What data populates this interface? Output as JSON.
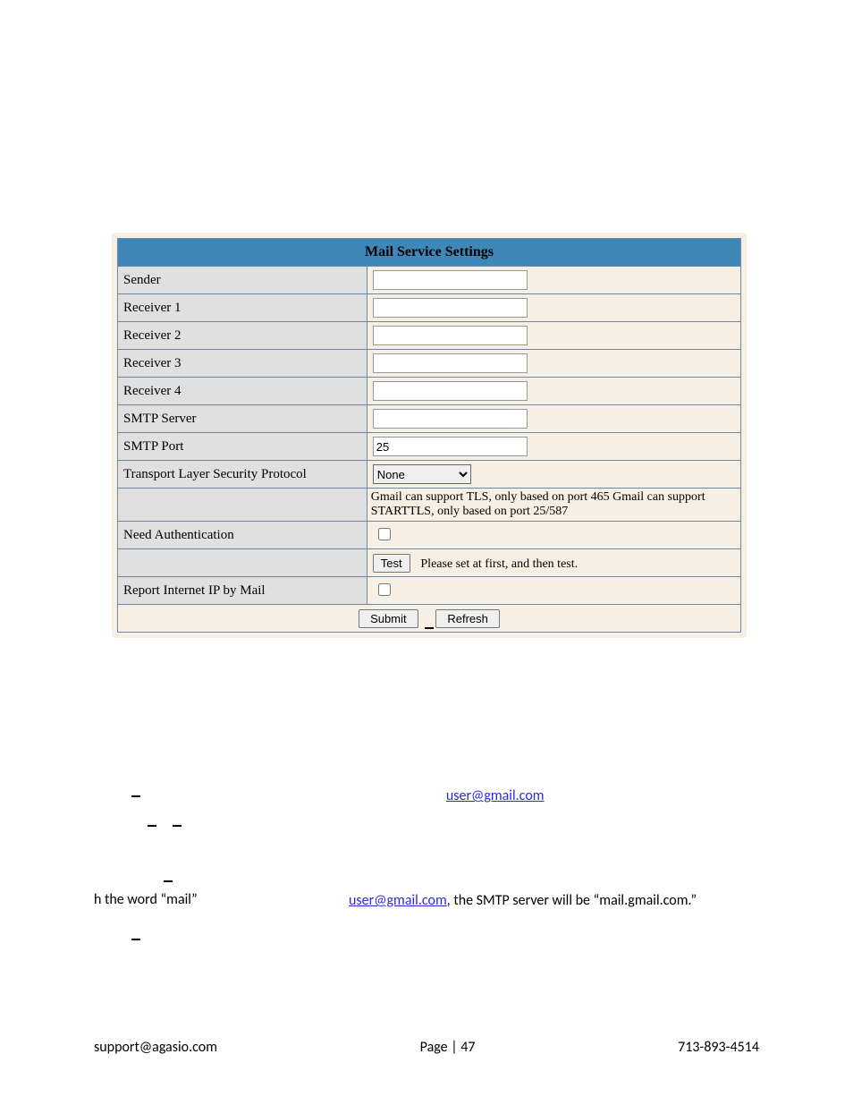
{
  "panel": {
    "title": "Mail Service Settings",
    "rows": {
      "sender": "Sender",
      "receiver1": "Receiver 1",
      "receiver2": "Receiver 2",
      "receiver3": "Receiver 3",
      "receiver4": "Receiver 4",
      "smtp_server": "SMTP Server",
      "smtp_port": "SMTP Port",
      "tls": "Transport Layer Security Protocol",
      "need_auth": "Need Authentication",
      "report_ip": "Report Internet IP by Mail"
    },
    "values": {
      "smtp_port": "25",
      "tls_selected": "None"
    },
    "tls_hint": "Gmail can support TLS, only based on port 465 Gmail can support STARTTLS, only based on port 25/587",
    "test_btn": "Test",
    "test_hint": "Please set at first, and then test.",
    "submit": "Submit",
    "refresh": "Refresh"
  },
  "prose": {
    "link1": "user@gmail.com",
    "line_mail": "h the word “mail”",
    "link2": "user@gmail.com",
    "line_mail_after": ", the SMTP server will be “mail.gmail.com.”"
  },
  "footer": {
    "email": "support@agasio.com",
    "page": "Page | 47",
    "phone": "713-893-4514"
  }
}
